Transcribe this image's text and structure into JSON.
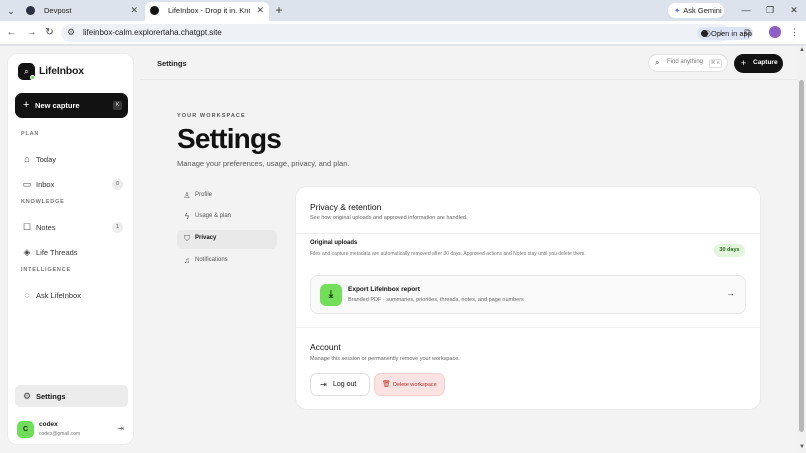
{
  "browser": {
    "tabs": [
      {
        "title": "Devpost",
        "active": false
      },
      {
        "title": "LifeInbox - Drop it in. Know wh",
        "active": true
      }
    ],
    "ask_gemini": "Ask Gemini",
    "url": "lifeinbox-calm.explorertaha.chatgpt.site",
    "open_in_app": "Open in app"
  },
  "sidebar": {
    "brand": "LifeInbox",
    "new_capture": "New capture",
    "new_capture_kbd": "K",
    "sections": {
      "plan": "PLAN",
      "knowledge": "KNOWLEDGE",
      "intelligence": "INTELLIGENCE"
    },
    "items": {
      "today": {
        "label": "Today",
        "icon": "sun-icon"
      },
      "inbox": {
        "label": "Inbox",
        "badge": "0",
        "icon": "inbox-icon"
      },
      "notes": {
        "label": "Notes",
        "badge": "1",
        "icon": "note-icon"
      },
      "threads": {
        "label": "Life Threads",
        "icon": "layers-icon"
      },
      "ask": {
        "label": "Ask LifeInbox",
        "icon": "chat-icon"
      },
      "settings": {
        "label": "Settings",
        "icon": "gear-icon"
      }
    },
    "user": {
      "initial": "C",
      "name": "codex",
      "email": "codex@gmail.com"
    }
  },
  "header": {
    "title": "Settings",
    "search_placeholder": "Find anything",
    "search_shortcut": "⌘ K",
    "capture": "Capture"
  },
  "main": {
    "eyebrow": "YOUR WORKSPACE",
    "title": "Settings",
    "subtitle": "Manage your preferences, usage, privacy, and plan.",
    "nav": [
      {
        "label": "Profile",
        "icon": "user-icon"
      },
      {
        "label": "Usage & plan",
        "icon": "bolt-icon"
      },
      {
        "label": "Privacy",
        "icon": "shield-icon"
      },
      {
        "label": "Notifications",
        "icon": "bell-icon"
      }
    ],
    "active_nav": "Privacy"
  },
  "privacy": {
    "title": "Privacy & retention",
    "desc": "See how original uploads and approved information are handled.",
    "originals_title": "Original uploads",
    "originals_desc": "Files and capture metadata are automatically removed after 30 days. Approved actions and Notes stay until you delete them.",
    "retention_badge": "30 days",
    "export_title": "Export LifeInbox report",
    "export_desc": "Branded PDF · summaries, priorities, threads, notes, and page numbers"
  },
  "account": {
    "title": "Account",
    "desc": "Manage this session or permanently remove your workspace.",
    "logout": "Log out",
    "delete": "Delete workspace"
  },
  "colors": {
    "accent_green": "#72de5a",
    "dark": "#121212",
    "danger": "#b3322a"
  }
}
